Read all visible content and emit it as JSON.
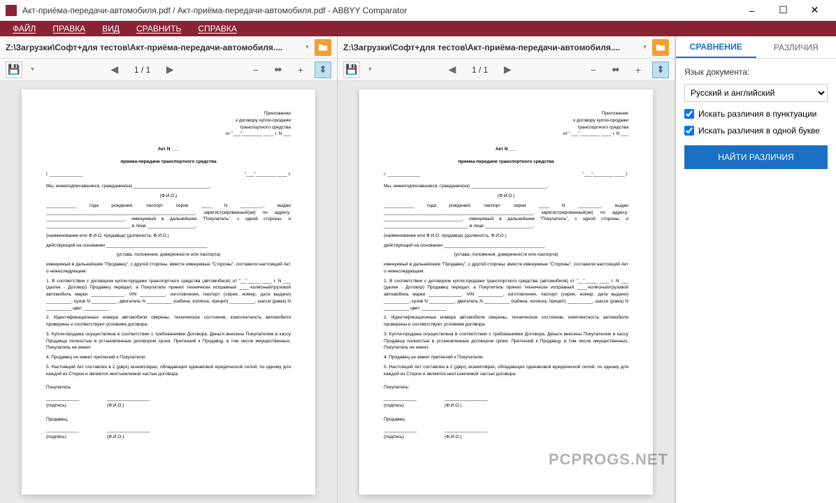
{
  "window": {
    "title": "Акт-приёма-передачи-автомобиля.pdf / Акт-приёма-передачи-автомобиля.pdf - ABBYY Comparator"
  },
  "menu": {
    "file": "ФАЙЛ",
    "edit": "ПРАВКА",
    "view": "ВИД",
    "compare": "СРАВНИТЬ",
    "help": "СПРАВКА"
  },
  "doc_left": {
    "path": "Z:\\Загрузки\\Софт+для тестов\\Акт-приёма-передачи-автомобиля....",
    "page": "1 / 1"
  },
  "doc_right": {
    "path": "Z:\\Загрузки\\Софт+для тестов\\Акт-приёма-передачи-автомобиля....",
    "page": "1 / 1"
  },
  "document": {
    "hdr1": "Приложение",
    "hdr2": "к договору купли-продажи",
    "hdr3": "транспортного средства",
    "hdr4": "от \"___\"________ ____ г. N ___",
    "title1": "Акт N ___",
    "title2": "приема-передачи транспортного средства",
    "line_city": "г. _____________",
    "line_date": "\"___\"________ ____ г.",
    "p1": "Мы, нижеподписавшиеся, гражданин(ка) ______________________________,",
    "p1a": "(Ф.И.О.)",
    "p2": "____________ года рождения, паспорт серии ____ N _________, выдан ___________________________________________________________, зарегистрированный(ая) по адресу: _______________________________, именуемый в дальнейшем \"Покупатель\", с одной стороны, и _________________________________, в лице ___________________,",
    "p3": "(наименование или Ф.И.О. продавца)            (должность, Ф.И.О.)",
    "p4": "действующий на основании ________________________________________",
    "p4a": "(устава, положения, доверенности или паспорта)",
    "p5": "именуемый в дальнейшем \"Продавец\", с другой стороны, вместе именуемые \"Стороны\", составили настоящий Акт о нижеследующем:",
    "p6": "1. В соответствии с договором купли-продажи транспортного средства (автомобиля) от \"__\"_____ ____ г. N ___ (далее - Договор) Продавец передал, а Покупатель принял технически исправный ____-колёсный/грузовой автомобиль марки _____________. VIN __________, изготовления, паспорт (серия, номер, дата выдачи) __________, кузов N __________, двигатель N __________ (кабина, коляска, прицеп) __________, шасси (рама) N __________ цвет __________.",
    "p7": "2. Идентификационные номера автомобиля сверены, техническое состояние, комплектность автомобиля проверены и соответствуют условиям договора.",
    "p8": "3. Купля-продажа осуществлена в соответствии с требованиями Договора. Деньги внесены Покупателем в кассу Продавца полностью в установленные договором сроки. Претензий к Продавцу, в том числе имущественных, Покупатель не имеет.",
    "p9": "4. Продавец не имеет претензий к Покупателю.",
    "p10": "5. Настоящий Акт составлен в 2 (двух) экземплярах, обладающих одинаковой юридической силой, по одному для каждой из Сторон и является неотъемлемой частью договора.",
    "buyer": "Покупатель:",
    "seller": "Продавец:",
    "sig": "(подпись)",
    "fio": "(Ф.И.О.)"
  },
  "sidebar": {
    "tab_compare": "СРАВНЕНИЕ",
    "tab_diff": "РАЗЛИЧИЯ",
    "lang_label": "Язык документа:",
    "lang_value": "Русский и английский",
    "check1": "Искать различия в пунктуации",
    "check2": "Искать различия в одной букве",
    "find_btn": "НАЙТИ РАЗЛИЧИЯ"
  },
  "watermark": "PCPROGS.NET"
}
